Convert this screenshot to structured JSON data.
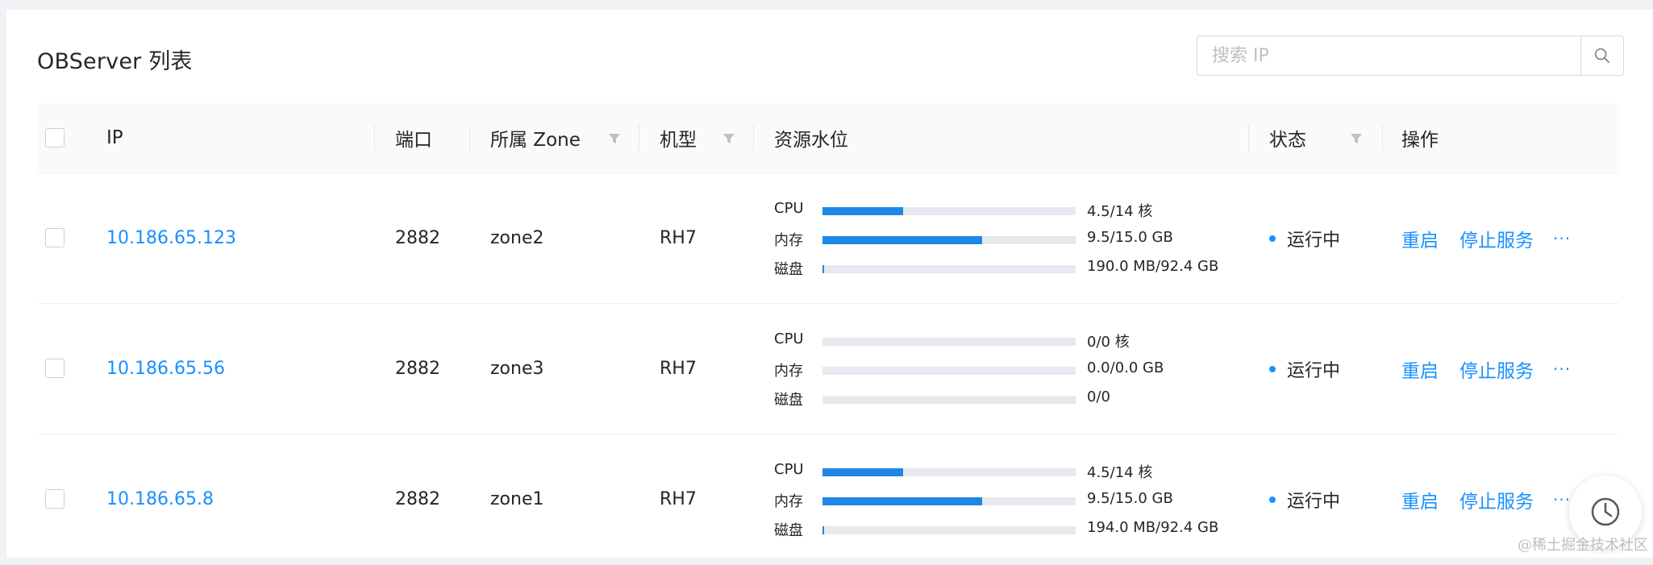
{
  "title": "OBServer 列表",
  "search": {
    "placeholder": "搜索 IP"
  },
  "columns": {
    "ip": "IP",
    "port": "端口",
    "zone": "所属 Zone",
    "model": "机型",
    "resource": "资源水位",
    "status": "状态",
    "actions": "操作"
  },
  "resource_labels": {
    "cpu": "CPU",
    "mem": "内存",
    "disk": "磁盘"
  },
  "rows": [
    {
      "ip": "10.186.65.123",
      "port": "2882",
      "zone": "zone2",
      "model": "RH7",
      "cpu_text": "4.5/14 核",
      "cpu_pct": 32,
      "mem_text": "9.5/15.0 GB",
      "mem_pct": 63,
      "disk_text": "190.0 MB/92.4 GB",
      "disk_pct": 0.4,
      "status": "运行中",
      "restart": "重启",
      "stop": "停止服务",
      "more": "···"
    },
    {
      "ip": "10.186.65.56",
      "port": "2882",
      "zone": "zone3",
      "model": "RH7",
      "cpu_text": "0/0 核",
      "cpu_pct": 0,
      "mem_text": "0.0/0.0 GB",
      "mem_pct": 0,
      "disk_text": "0/0",
      "disk_pct": 0,
      "status": "运行中",
      "restart": "重启",
      "stop": "停止服务",
      "more": "···"
    },
    {
      "ip": "10.186.65.8",
      "port": "2882",
      "zone": "zone1",
      "model": "RH7",
      "cpu_text": "4.5/14 核",
      "cpu_pct": 32,
      "mem_text": "9.5/15.0 GB",
      "mem_pct": 63,
      "disk_text": "194.0 MB/92.4 GB",
      "disk_pct": 0.4,
      "status": "运行中",
      "restart": "重启",
      "stop": "停止服务",
      "more": "···"
    }
  ],
  "watermark": "@稀土掘金技术社区",
  "colors": {
    "accent": "#1890ff",
    "bar": "#1e88e5",
    "track": "#e6e9ee"
  },
  "icons": {
    "search": "search-icon",
    "filter": "filter-icon",
    "clock": "clock-icon"
  }
}
